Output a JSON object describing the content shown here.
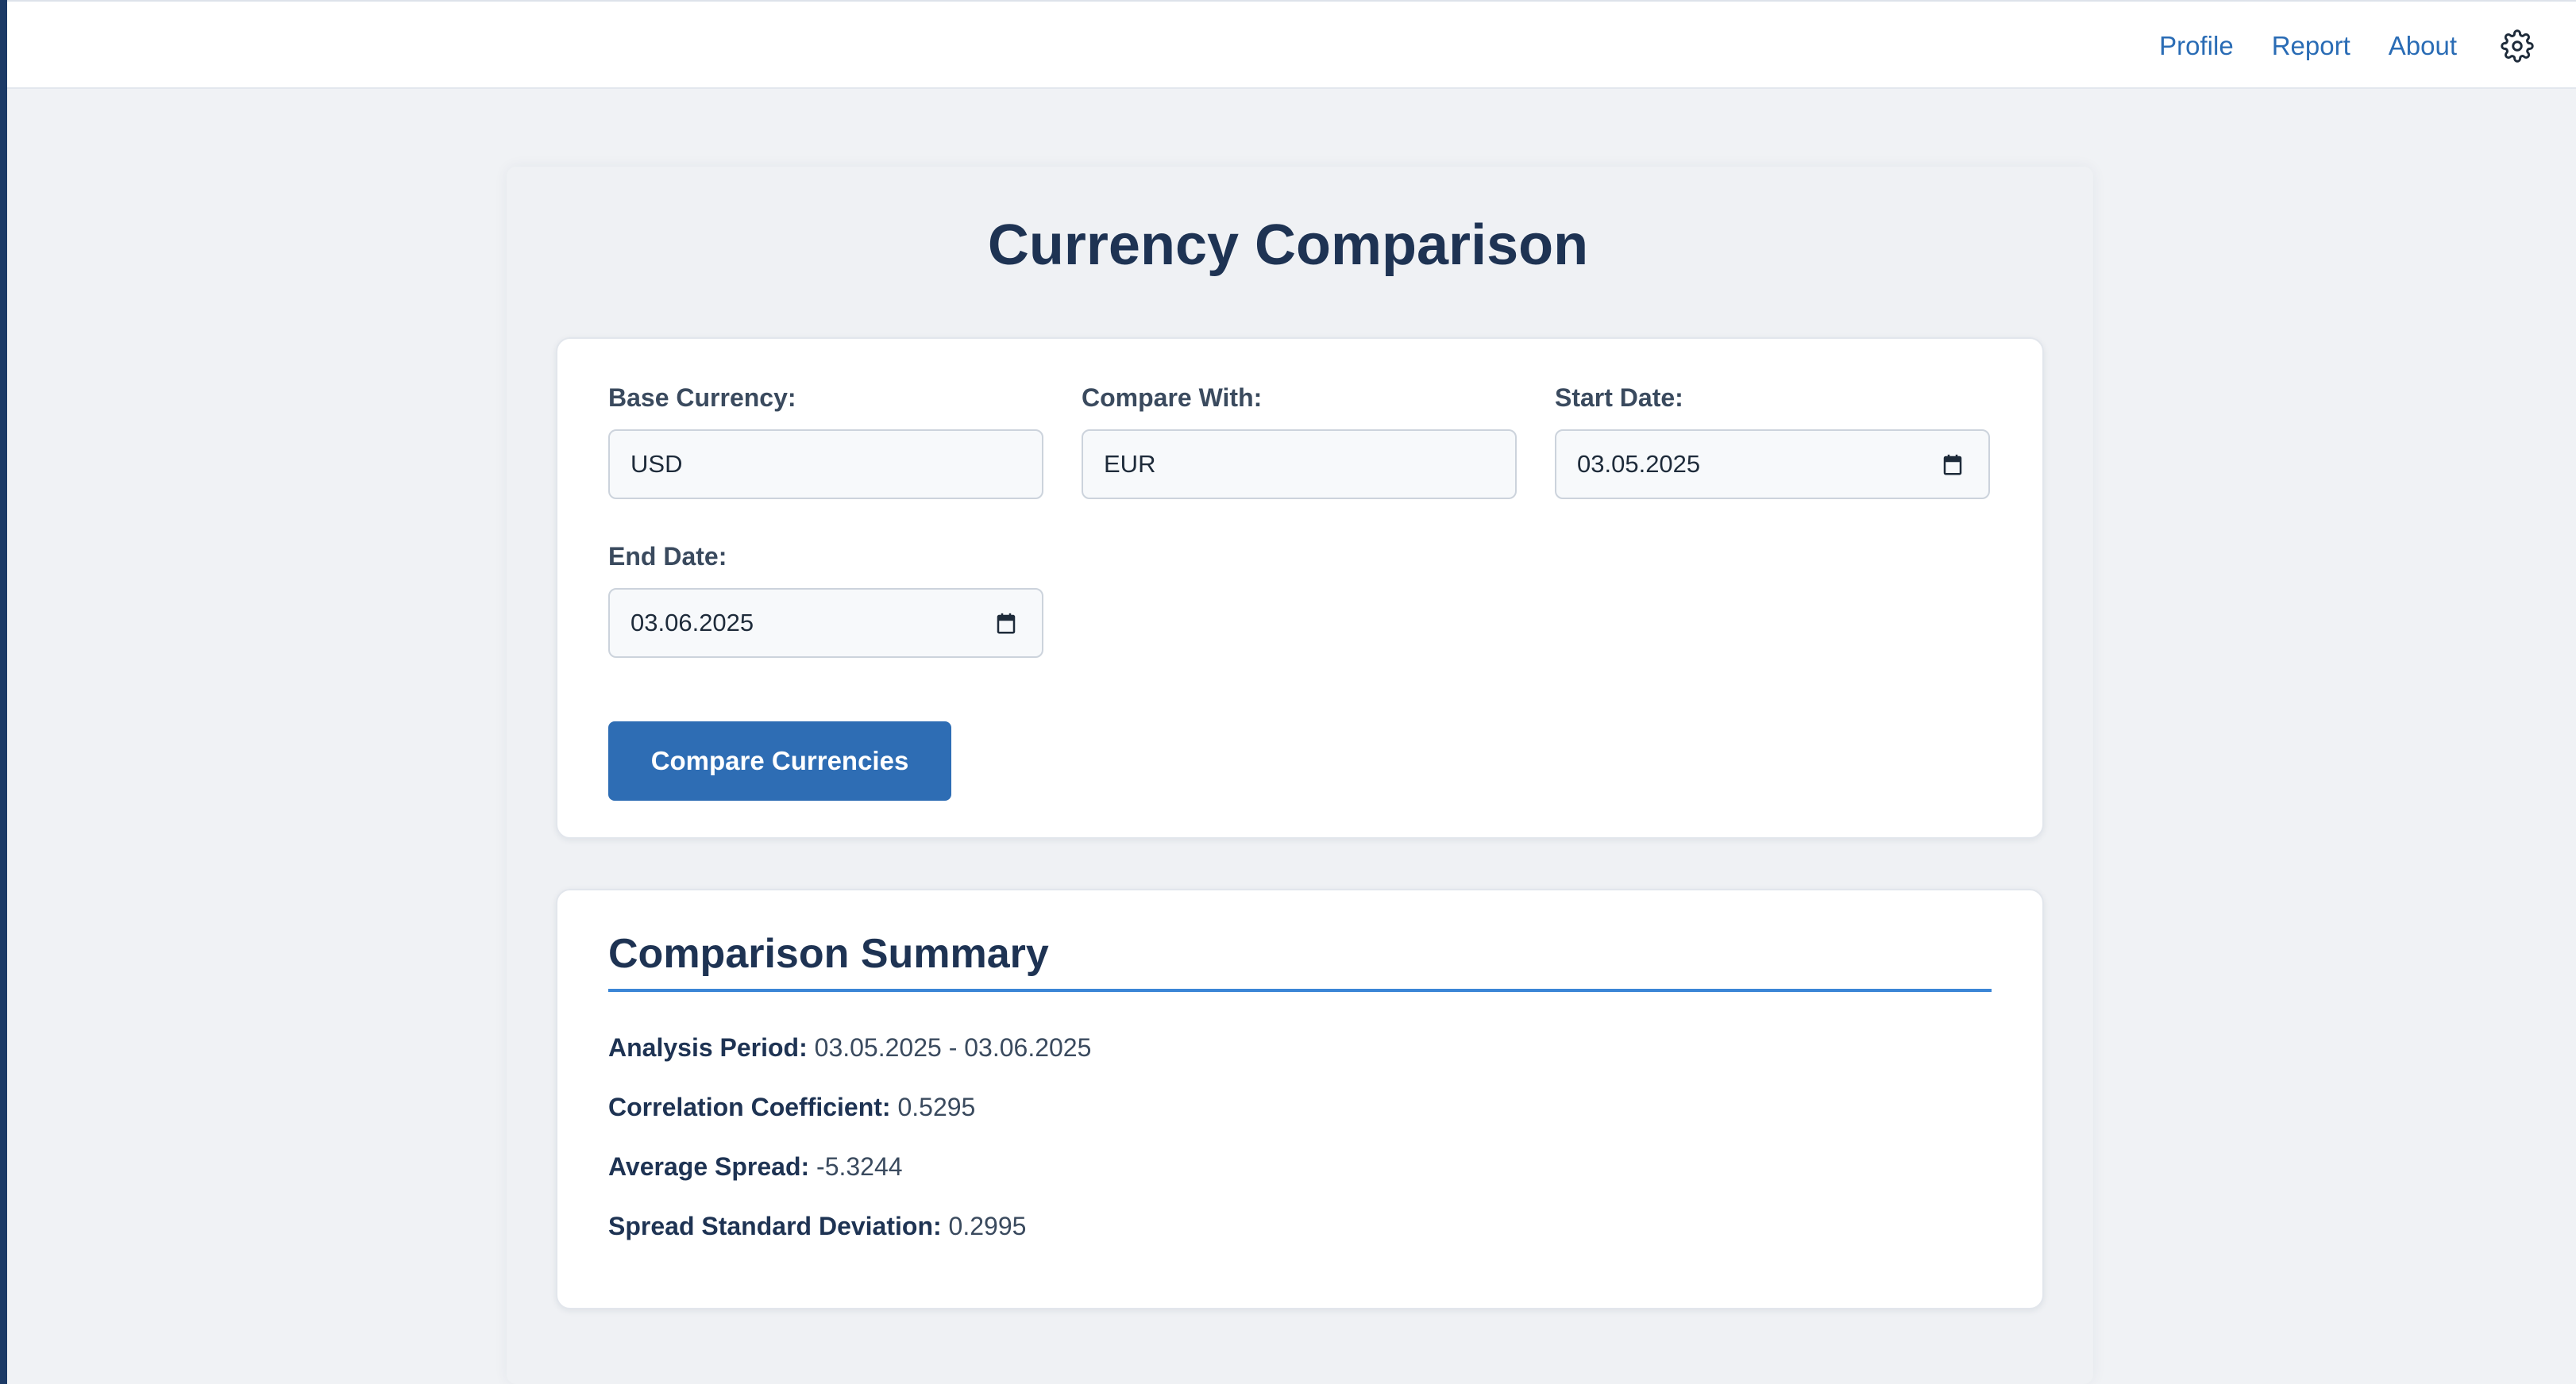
{
  "nav": {
    "profile": "Profile",
    "report": "Report",
    "about": "About",
    "settings_icon": "gear-icon"
  },
  "page": {
    "title": "Currency Comparison"
  },
  "form": {
    "base_currency_label": "Base Currency:",
    "base_currency_value": "USD",
    "compare_with_label": "Compare With:",
    "compare_with_value": "EUR",
    "start_date_label": "Start Date:",
    "start_date_value": "03.05.2025",
    "end_date_label": "End Date:",
    "end_date_value": "03.06.2025",
    "calendar_icon": "calendar-icon",
    "submit_label": "Compare Currencies"
  },
  "summary": {
    "title": "Comparison Summary",
    "analysis_period_label": "Analysis Period:",
    "analysis_period_value": "03.05.2025 - 03.06.2025",
    "correlation_label": "Correlation Coefficient:",
    "correlation_value": "0.5295",
    "avg_spread_label": "Average Spread:",
    "avg_spread_value": "-5.3244",
    "spread_std_label": "Spread Standard Deviation:",
    "spread_std_value": "0.2995"
  },
  "colors": {
    "accent": "#2e6db4",
    "link": "#2a6cb5",
    "heading": "#1e3353",
    "rule": "#3b86d6",
    "stripe": "#1c3a66",
    "background": "#f0f2f5"
  }
}
